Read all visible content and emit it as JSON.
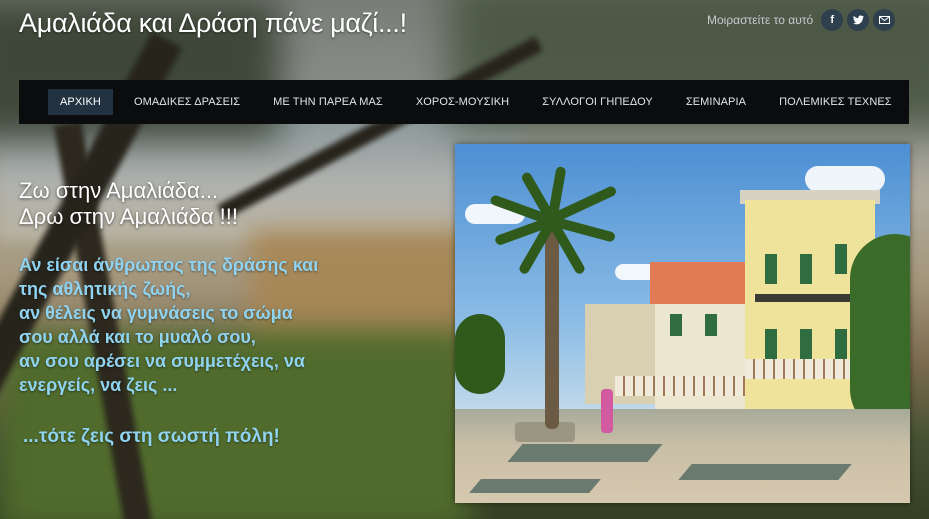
{
  "site": {
    "title": "Αμαλιάδα και Δράση πάνε μαζί...!"
  },
  "share": {
    "label": "Μοιραστείτε το αυτό",
    "icons": [
      "facebook-icon",
      "twitter-icon",
      "email-icon"
    ]
  },
  "nav": {
    "items": [
      {
        "label": "ΑΡΧΙΚΗ",
        "active": true
      },
      {
        "label": "ΟΜΑΔΙΚΕΣ ΔΡΑΣΕΙΣ"
      },
      {
        "label": "ΜΕ ΤΗΝ ΠΑΡΕΑ ΜΑΣ"
      },
      {
        "label": "ΧΟΡΟΣ-ΜΟΥΣΙΚΗ"
      },
      {
        "label": "ΣΥΛΛΟΓΟΙ ΓΗΠΕΔΟΥ"
      },
      {
        "label": "ΣΕΜΙΝΑΡΙΑ"
      },
      {
        "label": "ΠΟΛΕΜΙΚΕΣ ΤΕΧΝΕΣ"
      }
    ]
  },
  "content": {
    "heading": [
      "Ζω στην Αμαλιάδα...",
      "Δρω στην Αμαλιάδα !!!"
    ],
    "intro": [
      "Αν είσαι άνθρωπος της δράσης και",
      "της αθλητικής ζωής,",
      "αν θέλεις να γυμνάσεις το σώμα",
      "σου αλλά και το μυαλό σου,",
      "αν σου αρέσει να συμμετέχεις, να",
      "ενεργείς, να ζεις ..."
    ],
    "tagline": "...τότε ζεις στη σωστή πόλη!"
  },
  "colors": {
    "nav_bg": "#0b0c0d",
    "nav_active": "#233241",
    "intro_text": "#8fd3f0",
    "social_bg": "#2e3f4e"
  }
}
